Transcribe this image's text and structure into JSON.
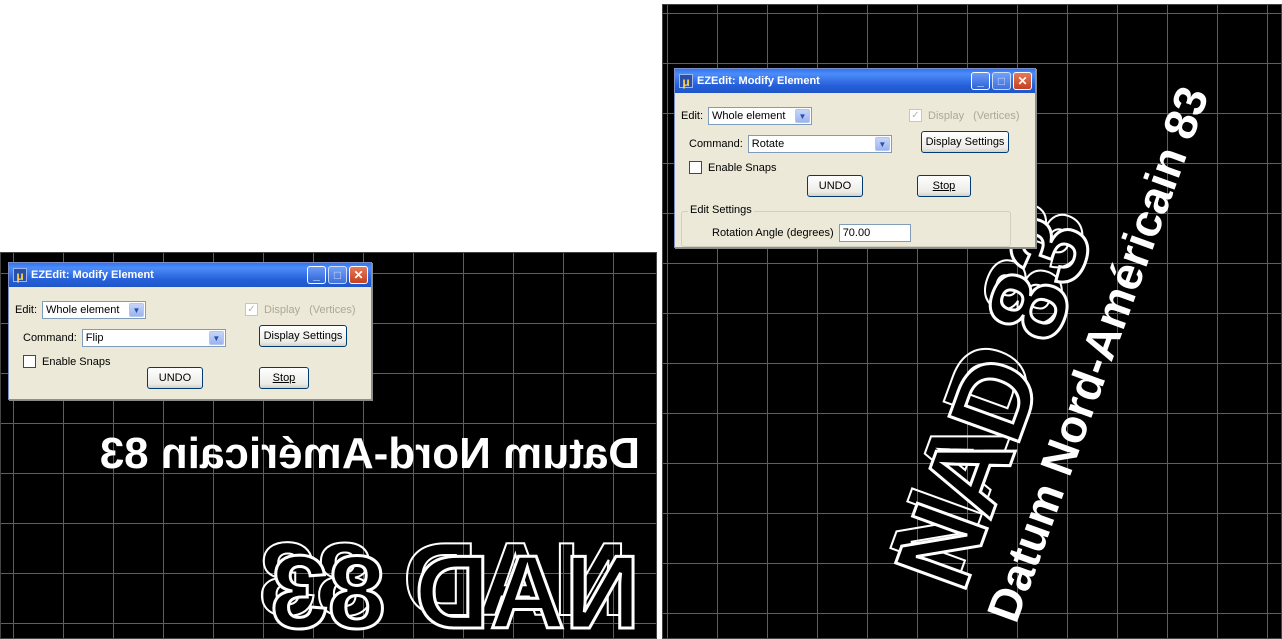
{
  "left_panel": {
    "dialog": {
      "title": "EZEdit: Modify Element",
      "edit_label": "Edit:",
      "edit_value": "Whole element",
      "display_label": "Display",
      "vertices_label": "(Vertices)",
      "command_label": "Command:",
      "command_value": "Flip",
      "display_settings_button": "Display Settings",
      "enable_snaps_label": "Enable Snaps",
      "undo_button": "UNDO",
      "stop_button": "Stop"
    },
    "drawing": {
      "line1": "Datum Nord-Américain 83",
      "line2": "NAD 83",
      "transform": "flipped"
    }
  },
  "right_panel": {
    "dialog": {
      "title": "EZEdit: Modify Element",
      "edit_label": "Edit:",
      "edit_value": "Whole element",
      "display_label": "Display",
      "vertices_label": "(Vertices)",
      "command_label": "Command:",
      "command_value": "Rotate",
      "display_settings_button": "Display Settings",
      "enable_snaps_label": "Enable Snaps",
      "undo_button": "UNDO",
      "stop_button": "Stop",
      "edit_settings_label": "Edit Settings",
      "rotation_angle_label": "Rotation Angle (degrees)",
      "rotation_angle_value": "70.00"
    },
    "drawing": {
      "line1": "Datum Nord-Américain 83",
      "line2": "NAD 83",
      "rotation_degrees": 70
    }
  },
  "colors": {
    "canvas_bg": "#000000",
    "grid": "#5e5e5e",
    "drawing": "#ffffff",
    "dialog_bg": "#ece9d8",
    "titlebar": "#2f74f5",
    "close": "#c4421f"
  }
}
